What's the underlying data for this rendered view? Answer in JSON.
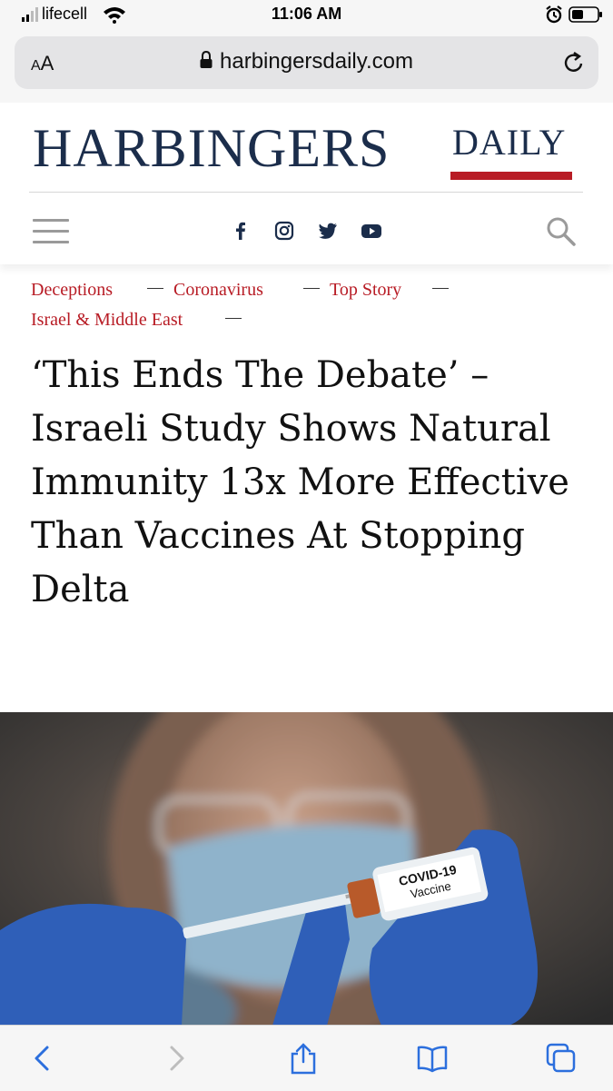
{
  "status_bar": {
    "carrier": "lifecell",
    "time": "11:06 AM",
    "icons": [
      "signal-icon",
      "wifi-icon",
      "alarm-icon",
      "battery-icon"
    ]
  },
  "browser": {
    "text_size_label_small": "A",
    "text_size_label_large": "A",
    "url": "harbingersdaily.com",
    "icons": [
      "lock-icon",
      "reload-icon"
    ]
  },
  "site": {
    "logo_main": "HARBINGERS",
    "logo_daily": "DAILY",
    "brand_color": "#1b2d4b",
    "accent_color": "#b81c25",
    "social_icons": [
      "facebook-icon",
      "instagram-icon",
      "twitter-icon",
      "youtube-icon"
    ]
  },
  "article": {
    "categories": [
      "Deceptions",
      "Coronavirus",
      "Top Story",
      "Israel & Middle East"
    ],
    "headline": "‘This Ends The Debate’ – Israeli Study Shows Natural Immunity 13x More Effective Than Vaccines At Stopping Delta",
    "image": {
      "vial_label_line1": "COVID-19",
      "vial_label_line2": "Vaccine"
    }
  },
  "toolbar": {
    "icons": [
      "back-icon",
      "forward-icon",
      "share-icon",
      "bookmarks-icon",
      "tabs-icon"
    ]
  }
}
